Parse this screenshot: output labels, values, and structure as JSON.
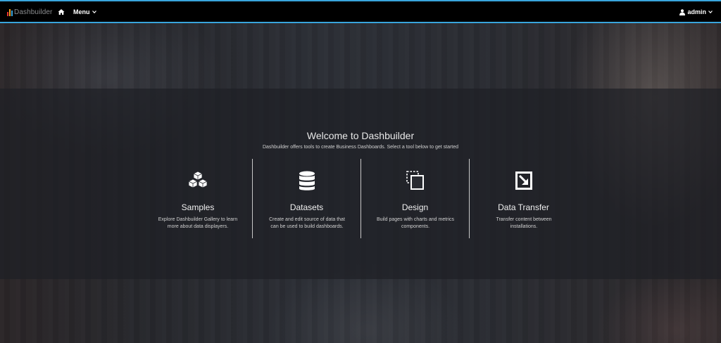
{
  "navbar": {
    "brand": "Dashbuilder",
    "brand_colors": [
      "#e8312f",
      "#f6a623",
      "#39a5dc"
    ],
    "home_icon": "home-icon",
    "menu_label": "Menu",
    "user_label": "admin",
    "user_icon": "user-icon",
    "accent_color": "#39a5dc"
  },
  "welcome": {
    "title": "Welcome to Dashbuilder",
    "subtitle": "Dashbuilder offers tools to create Business Dashboards. Select a tool below to get started"
  },
  "tools": [
    {
      "icon": "cubes-icon",
      "title": "Samples",
      "description": "Explore Dashbuilder Gallery to learn more about data displayers."
    },
    {
      "icon": "database-icon",
      "title": "Datasets",
      "description": "Create and edit source of data that can be used to build dashboards."
    },
    {
      "icon": "clone-icon",
      "title": "Design",
      "description": "Build pages with charts and metrics components."
    },
    {
      "icon": "import-arrow-icon",
      "title": "Data Transfer",
      "description": "Transfer content between installations."
    }
  ]
}
